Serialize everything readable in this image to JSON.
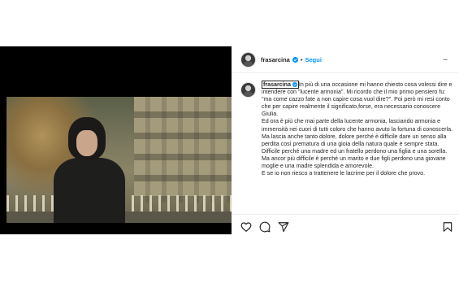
{
  "post": {
    "username": "frasarcina",
    "separator": "•",
    "follow_label": "Segui",
    "more_label": "...",
    "caption": {
      "username": "frasarcina",
      "paragraphs": [
        "In più di una occasione mi hanno chiesto cosa volessi dire e intendere con \"lucente armonia\". Mi ricordo che il mio primo pensiero fu: \"ma come cazzo fate a non capire cosa vuol dire?\". Poi però mi resi conto che per capire realmente il significato,forse, era necessario conoscere Giulia.",
        "Ed ora è più che mai parte della lucente armonia, lasciando armonia e immensità nei cuori di tutti coloro che hanno avuto la fortuna di conoscerla.",
        "Ma lascia anche tanto dolore, dolore perché è difficile dare un senso alla perdita così prematura di una gioia della natura quale è sempre stata. Difficile perché una madre ed un fratello perdono una figlia e una sorella. Ma ancor più difficile è perché un marito e due figli perdono una giovane moglie e una madre splendida e amorevole.",
        "E se io non riesco a trattenere le lacrime per il dolore che provo."
      ]
    },
    "icons": [
      "heart-icon",
      "comment-icon",
      "share-icon",
      "bookmark-icon"
    ],
    "colors": {
      "follow": "#0095f6",
      "verified": "#0095f6",
      "text": "#262626"
    }
  }
}
